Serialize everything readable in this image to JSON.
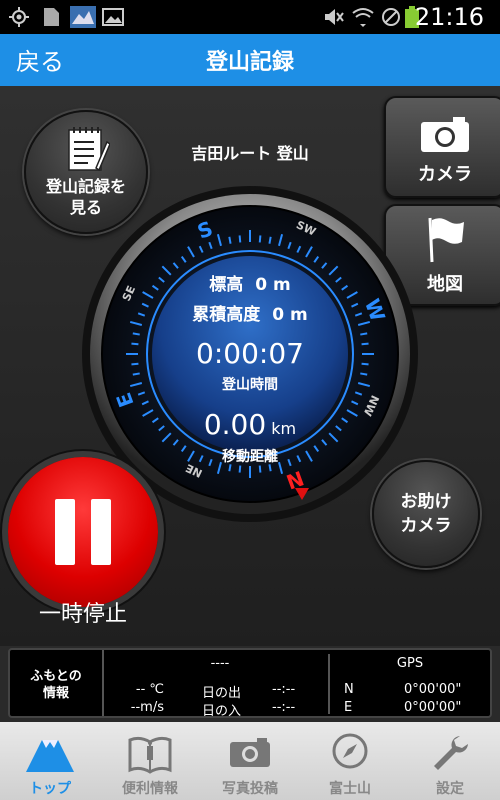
{
  "status": {
    "time": "21:16"
  },
  "nav": {
    "back_label": "戻る",
    "title": "登山記録"
  },
  "main": {
    "route": "吉田ルート 登山",
    "view_record": "登山記録を\n見る",
    "camera": "カメラ",
    "map": "地図",
    "help_camera": "お助け\nカメラ",
    "pause": "一時停止",
    "compass": {
      "altitude_label": "標高",
      "altitude_value": "0 m",
      "cumulative_label": "累積高度",
      "cumulative_value": "0 m",
      "time_value": "0:00:07",
      "time_label": "登山時間",
      "distance_value": "0.00",
      "distance_unit": "km",
      "distance_label": "移動距離",
      "directions": [
        "S",
        "SW",
        "W",
        "NW",
        "N",
        "NE",
        "E",
        "SE"
      ]
    }
  },
  "panel": {
    "title": "ふもとの\n情報",
    "dashes": "----",
    "temp": "-- ℃",
    "wind": "--m/s",
    "sunrise_label": "日の出",
    "sunrise_value": "--:--",
    "sunset_label": "日の入",
    "sunset_value": "--:--",
    "gps_label": "GPS",
    "n_label": "N",
    "n_value": "0°00'00\"",
    "e_label": "E",
    "e_value": "0°00'00\""
  },
  "tabs": [
    {
      "label": "トップ",
      "icon": "mountain-icon",
      "active": true
    },
    {
      "label": "便利情報",
      "icon": "book-icon"
    },
    {
      "label": "写真投稿",
      "icon": "camera-icon"
    },
    {
      "label": "富士山",
      "icon": "compass-icon"
    },
    {
      "label": "設定",
      "icon": "wrench-icon"
    }
  ],
  "colors": {
    "nav_blue": "#1e8fe6",
    "pause_red": "#dd0000",
    "accent_blue": "#1e8fe6"
  }
}
